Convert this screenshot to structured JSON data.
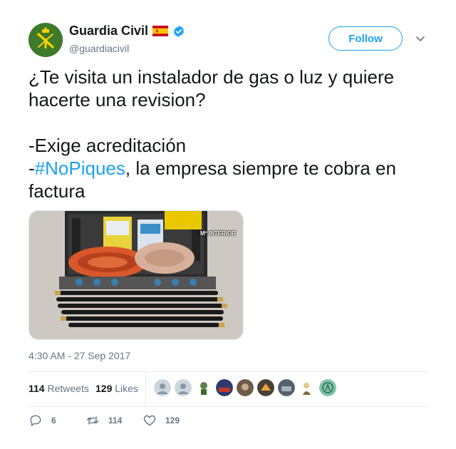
{
  "tweet": {
    "display_name": "Guardia Civil",
    "handle": "@guardiacivil",
    "follow_label": "Follow",
    "text_line1": "¿Te visita un instalador de gas o luz y quiere hacerte una revision?",
    "text_line2": "-Exige acreditación",
    "text_line3_prefix": "-",
    "hashtag": "#NoPiques",
    "text_line3_suffix": ", la empresa siempre te cobra en factura",
    "media_watermark": "Mº INTERIOR",
    "timestamp": "4:30 AM - 27 Sep 2017"
  },
  "stats": {
    "retweets_count": "114",
    "retweets_label": "Retweets",
    "likes_count": "129",
    "likes_label": "Likes"
  },
  "actions": {
    "reply_count": "6",
    "retweet_count": "114",
    "like_count": "129"
  },
  "colors": {
    "accent": "#1da1f2",
    "text": "#14171a",
    "secondary": "#657786",
    "border": "#e6ecf0",
    "avatar_bg": "#3d7a2a"
  },
  "icons": {
    "verified": "verified-badge-icon",
    "flag": "spain-flag-icon",
    "caret": "chevron-down-icon",
    "reply": "reply-icon",
    "retweet": "retweet-icon",
    "like": "heart-icon"
  }
}
